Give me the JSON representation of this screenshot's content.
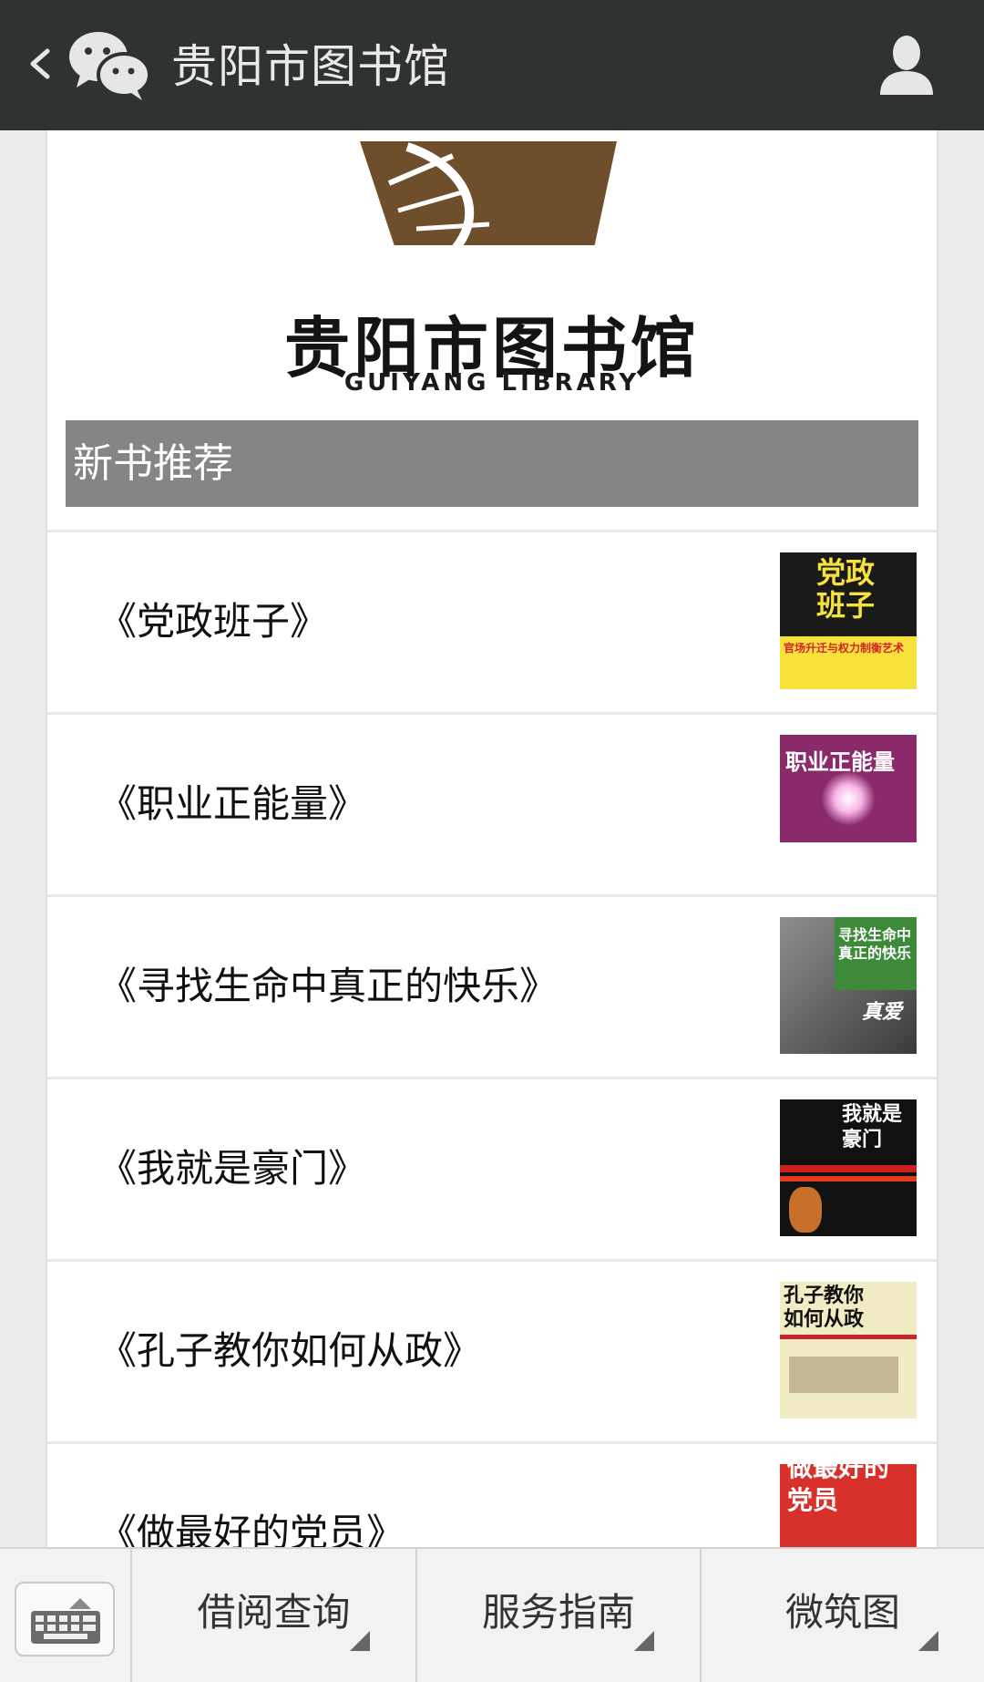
{
  "header": {
    "title": "贵阳市图书馆",
    "icons": [
      "back-icon",
      "wechat-icon",
      "user-icon"
    ]
  },
  "logo": {
    "name_cn": "贵阳市图书馆",
    "name_en": "GUIYANG LIBRARY",
    "brand_color": "#6f4e2c"
  },
  "section": {
    "title": "新书推荐"
  },
  "books": [
    {
      "title": "《党政班子》",
      "cover": {
        "main": "党政\n班子",
        "sub": "官场升迁与权力制衡艺术",
        "bg": "#1a1a1a",
        "fg": "#f6e23a"
      }
    },
    {
      "title": "《职业正能量》",
      "cover": {
        "main": "职业正能量",
        "sub": "",
        "bg": "#8a2a6a",
        "fg": "#ffffff"
      }
    },
    {
      "title": "《寻找生命中真正的快乐》",
      "cover": {
        "main": "寻找生命中\n真正的快乐",
        "sub": "真爱",
        "bg": "#5e5e5e",
        "fg": "#ffffff"
      }
    },
    {
      "title": "《我就是豪门》",
      "cover": {
        "main": "我就是\n豪门",
        "sub": "",
        "bg": "#111111",
        "fg": "#ffffff"
      }
    },
    {
      "title": "《孔子教你如何从政》",
      "cover": {
        "main": "孔子教你\n如何从政",
        "sub": "",
        "bg": "#f2ecc4",
        "fg": "#111111"
      }
    },
    {
      "title": "《做最好的党员》",
      "cover": {
        "main": "做最好的\n党员",
        "sub": "",
        "bg": "#d8302b",
        "fg": "#ffffff"
      }
    }
  ],
  "bottom_menu": {
    "items": [
      {
        "label": "借阅查询"
      },
      {
        "label": "服务指南"
      },
      {
        "label": "微筑图"
      }
    ],
    "icons": [
      "keyboard-icon"
    ]
  }
}
